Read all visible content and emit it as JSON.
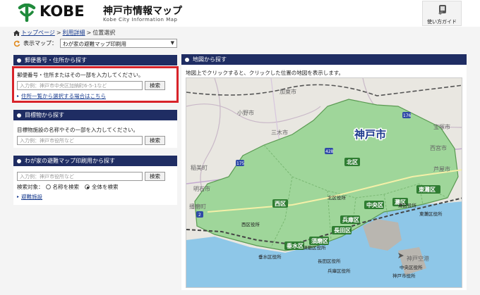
{
  "header": {
    "logo_text": "KOBE",
    "site_title": "神戸市情報マップ",
    "site_subtitle": "Kobe City Information Map",
    "help_label": "使い方ガイド"
  },
  "breadcrumb": {
    "items": [
      "トップページ",
      "利用詳細",
      "位置選択"
    ],
    "separator": ">"
  },
  "map_type": {
    "label": "表示マップ：",
    "selected": "わが家の避難マップ印刷用"
  },
  "postal_search": {
    "title": "郵便番号・住所から探す",
    "description": "郵便番号・住所またはその一部を入力してください。",
    "placeholder": "入力例：神戸市中央区加納町6-5-1など",
    "search_button": "検索",
    "list_link": "住所一覧から選択する場合はこちら"
  },
  "landmark_search": {
    "title": "目標物から探す",
    "description": "目標物施設の名称やその一部を入力してください。",
    "placeholder": "入力例：神戸市役所など",
    "search_button": "検索"
  },
  "evac_search": {
    "title": "わが家の避難マップ印刷用から探す",
    "placeholder": "入力例：神戸市役所など",
    "search_button": "検索",
    "scope_label": "検索対象：",
    "option_name": "名称を検索",
    "option_all": "全体を検索",
    "facility_link": "避難施設"
  },
  "map_search": {
    "title": "地図から探す",
    "description": "地図上でクリックすると、クリックした位置の地図を表示します。"
  },
  "map": {
    "city_label": "神戸市",
    "ward_labels": [
      "北区",
      "西区",
      "垂水区",
      "須磨区",
      "長田区",
      "兵庫区",
      "中央区",
      "灘区",
      "東灘区"
    ],
    "office_labels": [
      "北区役所",
      "西区役所",
      "垂水区役所",
      "須磨区役所",
      "長田区役所",
      "兵庫区役所",
      "中央区役所",
      "灘区役所",
      "東灘区役所",
      "神戸市役所"
    ],
    "place_labels": [
      "加東市",
      "小野市",
      "三木市",
      "宝塚市",
      "西宮市",
      "芦屋市",
      "稲美町",
      "明石市",
      "播磨町",
      "神戸空港"
    ],
    "route_numbers": [
      "176",
      "428",
      "175",
      "2"
    ],
    "colors": {
      "city_fill": "#9fd69a",
      "city_border": "#5a9a52",
      "sea": "#8ec7e8",
      "label_bg": "#2f7d32"
    }
  },
  "colors": {
    "panel_header": "#1f2d63",
    "highlight": "#d8232a",
    "link": "#1a3d8f"
  }
}
